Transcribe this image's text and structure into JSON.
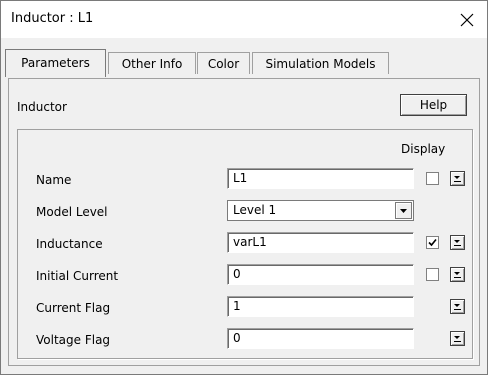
{
  "window": {
    "title": "Inductor : L1",
    "close_icon": "close-icon"
  },
  "tabs": [
    {
      "label": "Parameters",
      "active": true
    },
    {
      "label": "Other Info",
      "active": false
    },
    {
      "label": "Color",
      "active": false
    },
    {
      "label": "Simulation Models",
      "active": false
    }
  ],
  "panel": {
    "section_label": "Inductor",
    "help_label": "Help",
    "display_header": "Display"
  },
  "rows": [
    {
      "label": "Name",
      "value": "L1",
      "type": "text",
      "has_checkbox": true,
      "checked": false
    },
    {
      "label": "Model Level",
      "value": "Level 1",
      "type": "select"
    },
    {
      "label": "Inductance",
      "value": "varL1",
      "type": "text",
      "has_checkbox": true,
      "checked": true
    },
    {
      "label": "Initial Current",
      "value": "0",
      "type": "text",
      "has_checkbox": true,
      "checked": false
    },
    {
      "label": "Current Flag",
      "value": "1",
      "type": "text",
      "has_checkbox": false
    },
    {
      "label": "Voltage Flag",
      "value": "0",
      "type": "text",
      "has_checkbox": false
    }
  ]
}
